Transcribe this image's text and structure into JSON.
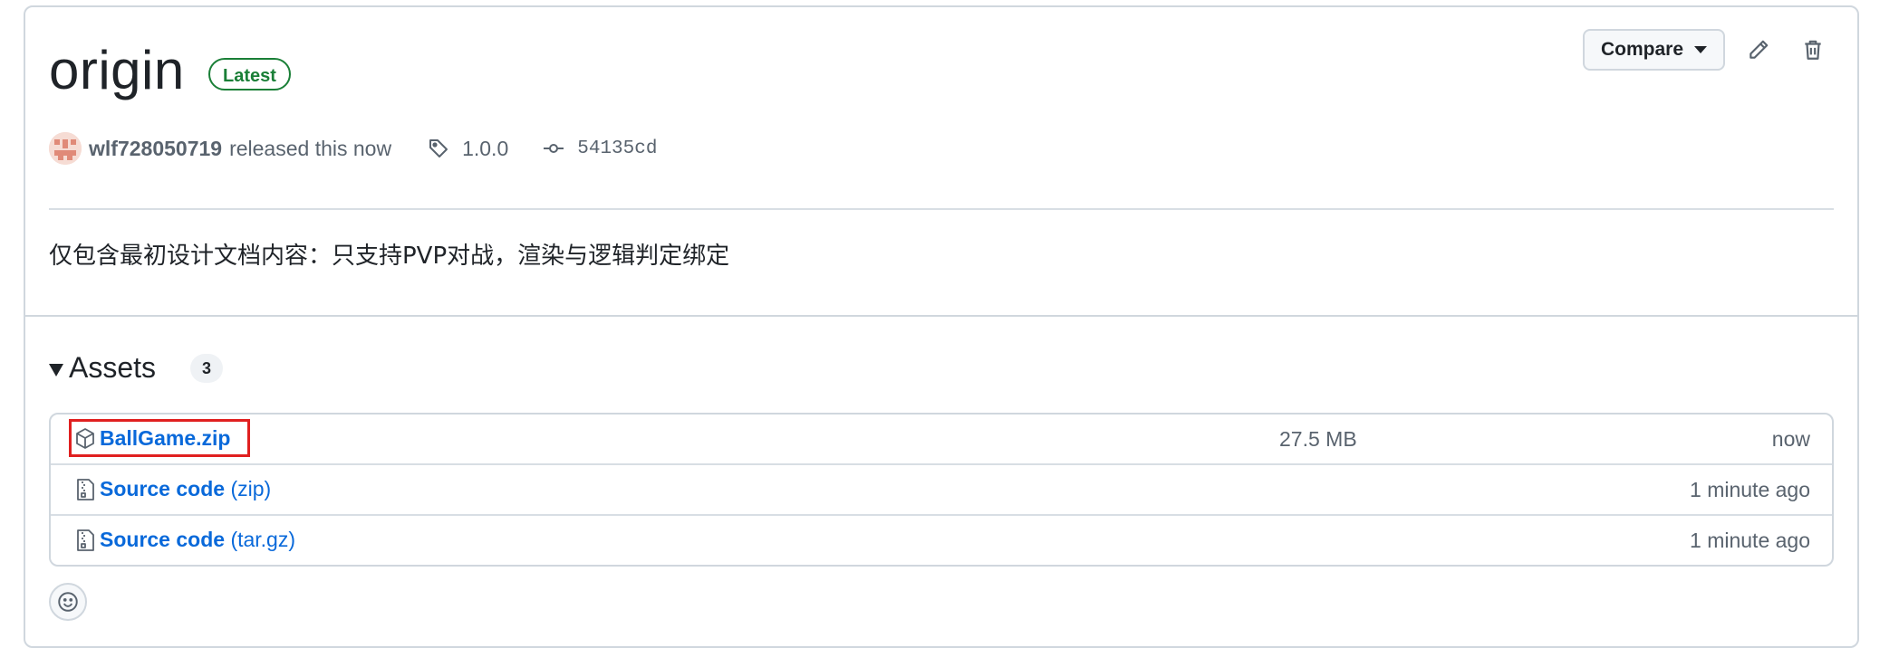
{
  "release": {
    "title": "origin",
    "badge": "Latest",
    "author": "wlf728050719",
    "released_text": "released this now",
    "tag": "1.0.0",
    "commit": "54135cd",
    "description": "仅包含最初设计文档内容：只支持PVP对战，渲染与逻辑判定绑定"
  },
  "actions": {
    "compare_label": "Compare",
    "edit_icon": "pencil-icon",
    "delete_icon": "trash-icon"
  },
  "assets": {
    "title": "Assets",
    "count": "3",
    "items": [
      {
        "name": "BallGame.zip",
        "ext": "",
        "size": "27.5 MB",
        "when": "now",
        "icon": "package-icon"
      },
      {
        "name": "Source code",
        "ext": "(zip)",
        "size": "",
        "when": "1 minute ago",
        "icon": "file-zip-icon"
      },
      {
        "name": "Source code",
        "ext": "(tar.gz)",
        "size": "",
        "when": "1 minute ago",
        "icon": "file-zip-icon"
      }
    ]
  },
  "colors": {
    "link": "#0969da",
    "latest": "#1a7f37",
    "highlight": "#e02020",
    "muted": "#59636e"
  }
}
